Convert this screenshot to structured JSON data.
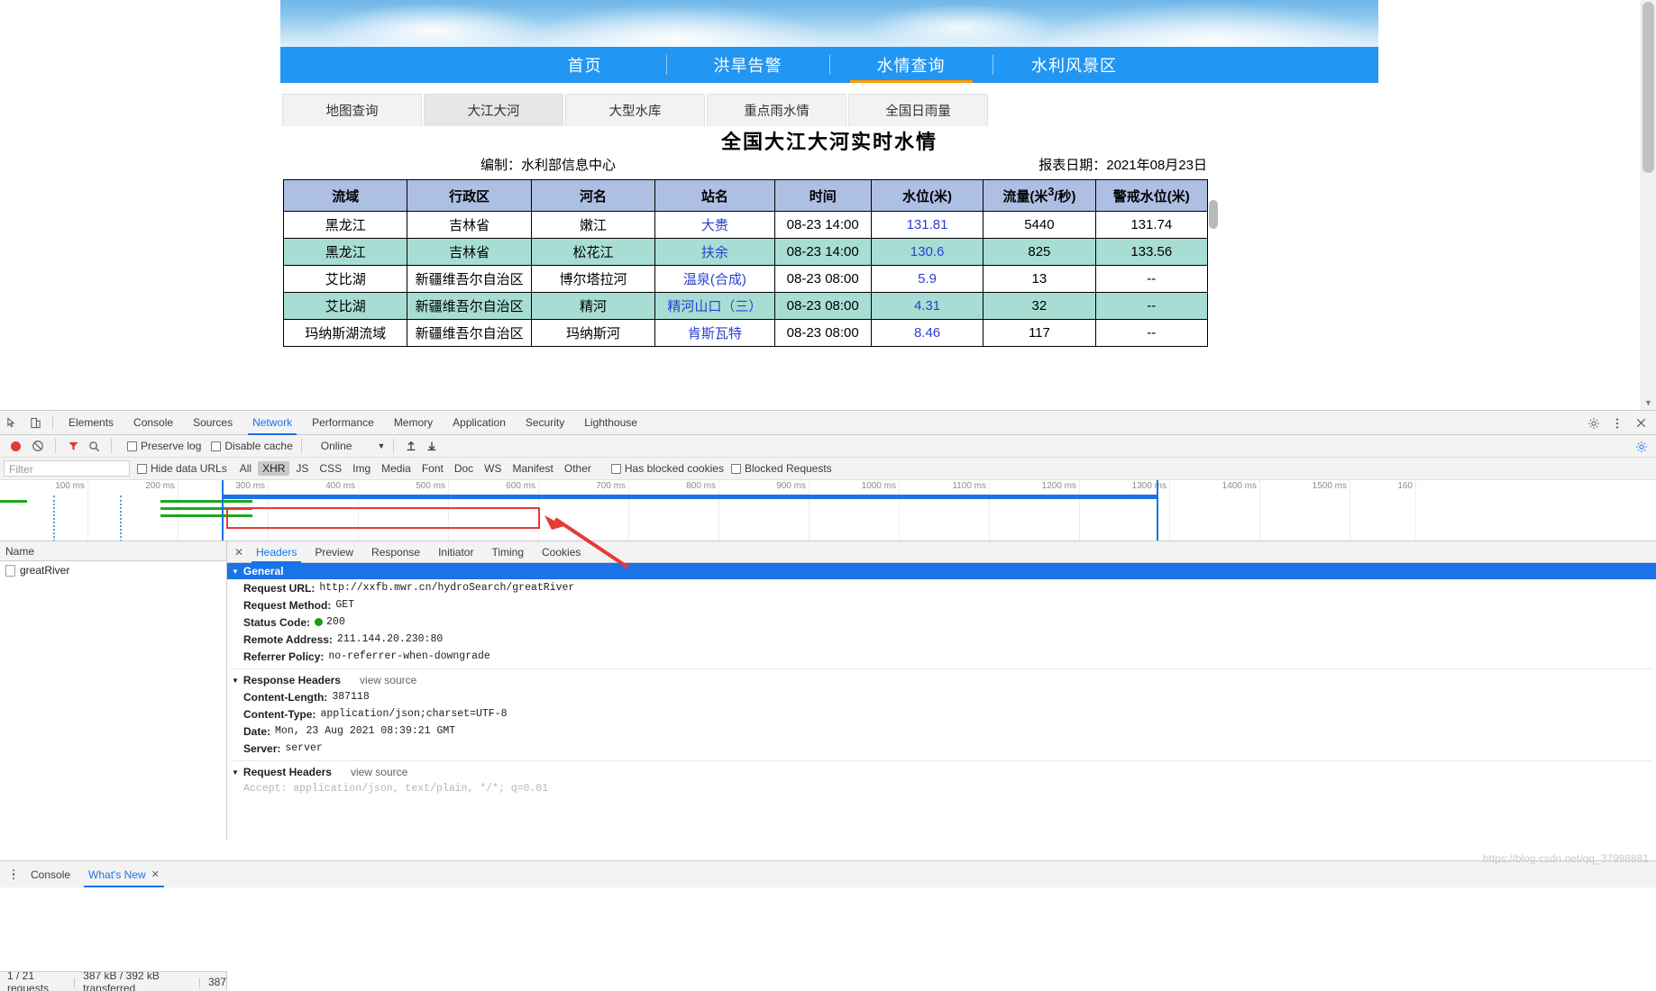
{
  "site": {
    "nav": [
      {
        "label": "首页",
        "active": false
      },
      {
        "label": "洪旱告警",
        "active": false
      },
      {
        "label": "水情查询",
        "active": true
      },
      {
        "label": "水利风景区",
        "active": false
      }
    ],
    "subtabs": [
      {
        "label": "地图查询",
        "active": false
      },
      {
        "label": "大江大河",
        "active": true
      },
      {
        "label": "大型水库",
        "active": false
      },
      {
        "label": "重点雨水情",
        "active": false
      },
      {
        "label": "全国日雨量",
        "active": false
      }
    ],
    "report": {
      "title": "全国大江大河实时水情",
      "author": "编制：水利部信息中心",
      "date": "报表日期：2021年08月23日"
    },
    "table": {
      "columns": [
        "流域",
        "行政区",
        "河名",
        "站名",
        "时间",
        "水位(米)",
        "流量(米³/秒)",
        "警戒水位(米)"
      ],
      "rows": [
        [
          "黑龙江",
          "吉林省",
          "嫩江",
          "大赉",
          "08-23 14:00",
          "131.81",
          "5440",
          "131.74"
        ],
        [
          "黑龙江",
          "吉林省",
          "松花江",
          "扶余",
          "08-23 14:00",
          "130.6",
          "825",
          "133.56"
        ],
        [
          "艾比湖",
          "新疆维吾尔自治区",
          "博尔塔拉河",
          "温泉(合成)",
          "08-23 08:00",
          "5.9",
          "13",
          "--"
        ],
        [
          "艾比湖",
          "新疆维吾尔自治区",
          "精河",
          "精河山口（三）",
          "08-23 08:00",
          "4.31",
          "32",
          "--"
        ],
        [
          "玛纳斯湖流域",
          "新疆维吾尔自治区",
          "玛纳斯河",
          "肯斯瓦特",
          "08-23 08:00",
          "8.46",
          "117",
          "--"
        ]
      ]
    }
  },
  "devtools": {
    "tabs": [
      {
        "label": "Elements",
        "active": false
      },
      {
        "label": "Console",
        "active": false
      },
      {
        "label": "Sources",
        "active": false
      },
      {
        "label": "Network",
        "active": true
      },
      {
        "label": "Performance",
        "active": false
      },
      {
        "label": "Memory",
        "active": false
      },
      {
        "label": "Application",
        "active": false
      },
      {
        "label": "Security",
        "active": false
      },
      {
        "label": "Lighthouse",
        "active": false
      }
    ],
    "toolbar": {
      "preserve_log": "Preserve log",
      "disable_cache": "Disable cache",
      "throttle": "Online"
    },
    "filter": {
      "placeholder": "Filter",
      "hide_data_urls": "Hide data URLs",
      "types": [
        {
          "label": "All",
          "active": false
        },
        {
          "label": "XHR",
          "active": true
        },
        {
          "label": "JS",
          "active": false
        },
        {
          "label": "CSS",
          "active": false
        },
        {
          "label": "Img",
          "active": false
        },
        {
          "label": "Media",
          "active": false
        },
        {
          "label": "Font",
          "active": false
        },
        {
          "label": "Doc",
          "active": false
        },
        {
          "label": "WS",
          "active": false
        },
        {
          "label": "Manifest",
          "active": false
        },
        {
          "label": "Other",
          "active": false
        }
      ],
      "has_blocked_cookies": "Has blocked cookies",
      "blocked_requests": "Blocked Requests"
    },
    "overview_ticks": [
      "100 ms",
      "200 ms",
      "300 ms",
      "400 ms",
      "500 ms",
      "600 ms",
      "700 ms",
      "800 ms",
      "900 ms",
      "1000 ms",
      "1100 ms",
      "1200 ms",
      "1300 ms",
      "1400 ms",
      "1500 ms",
      "160"
    ],
    "request_list": {
      "header": "Name",
      "items": [
        {
          "name": "greatRiver",
          "selected": true
        }
      ]
    },
    "detail_tabs": [
      {
        "label": "Headers",
        "active": true
      },
      {
        "label": "Preview",
        "active": false
      },
      {
        "label": "Response",
        "active": false
      },
      {
        "label": "Initiator",
        "active": false
      },
      {
        "label": "Timing",
        "active": false
      },
      {
        "label": "Cookies",
        "active": false
      }
    ],
    "headers": {
      "general": {
        "section": "General",
        "rows": [
          {
            "key": "Request URL:",
            "value": "http://xxfb.mwr.cn/hydroSearch/greatRiver",
            "highlight": true
          },
          {
            "key": "Request Method:",
            "value": "GET"
          },
          {
            "key": "Status Code:",
            "value": "200",
            "status": true
          },
          {
            "key": "Remote Address:",
            "value": "211.144.20.230:80"
          },
          {
            "key": "Referrer Policy:",
            "value": "no-referrer-when-downgrade"
          }
        ]
      },
      "response": {
        "section": "Response Headers",
        "view_source": "view source",
        "rows": [
          {
            "key": "Content-Length:",
            "value": "387118"
          },
          {
            "key": "Content-Type:",
            "value": "application/json;charset=UTF-8"
          },
          {
            "key": "Date:",
            "value": "Mon, 23 Aug 2021 08:39:21 GMT"
          },
          {
            "key": "Server:",
            "value": "server"
          }
        ]
      },
      "request": {
        "section": "Request Headers",
        "view_source": "view source"
      }
    },
    "status_bar": {
      "requests": "1 / 21 requests",
      "transferred": "387 kB / 392 kB transferred",
      "resources": "387"
    },
    "drawer_tabs": [
      {
        "label": "Console",
        "active": false,
        "closable": false
      },
      {
        "label": "What's New",
        "active": true,
        "closable": true
      }
    ]
  },
  "watermark": "https://blog.csdn.net/qq_37998881",
  "colors": {
    "nav_blue": "#2196f3",
    "nav_active_underline": "#ff9800",
    "table_header": "#aebfe4",
    "table_alt_row": "#a8ddd4",
    "link_blue": "#2b3fd0",
    "devtools_accent": "#1a73e8",
    "highlight_red": "#e53935",
    "status_green": "#15a015"
  }
}
